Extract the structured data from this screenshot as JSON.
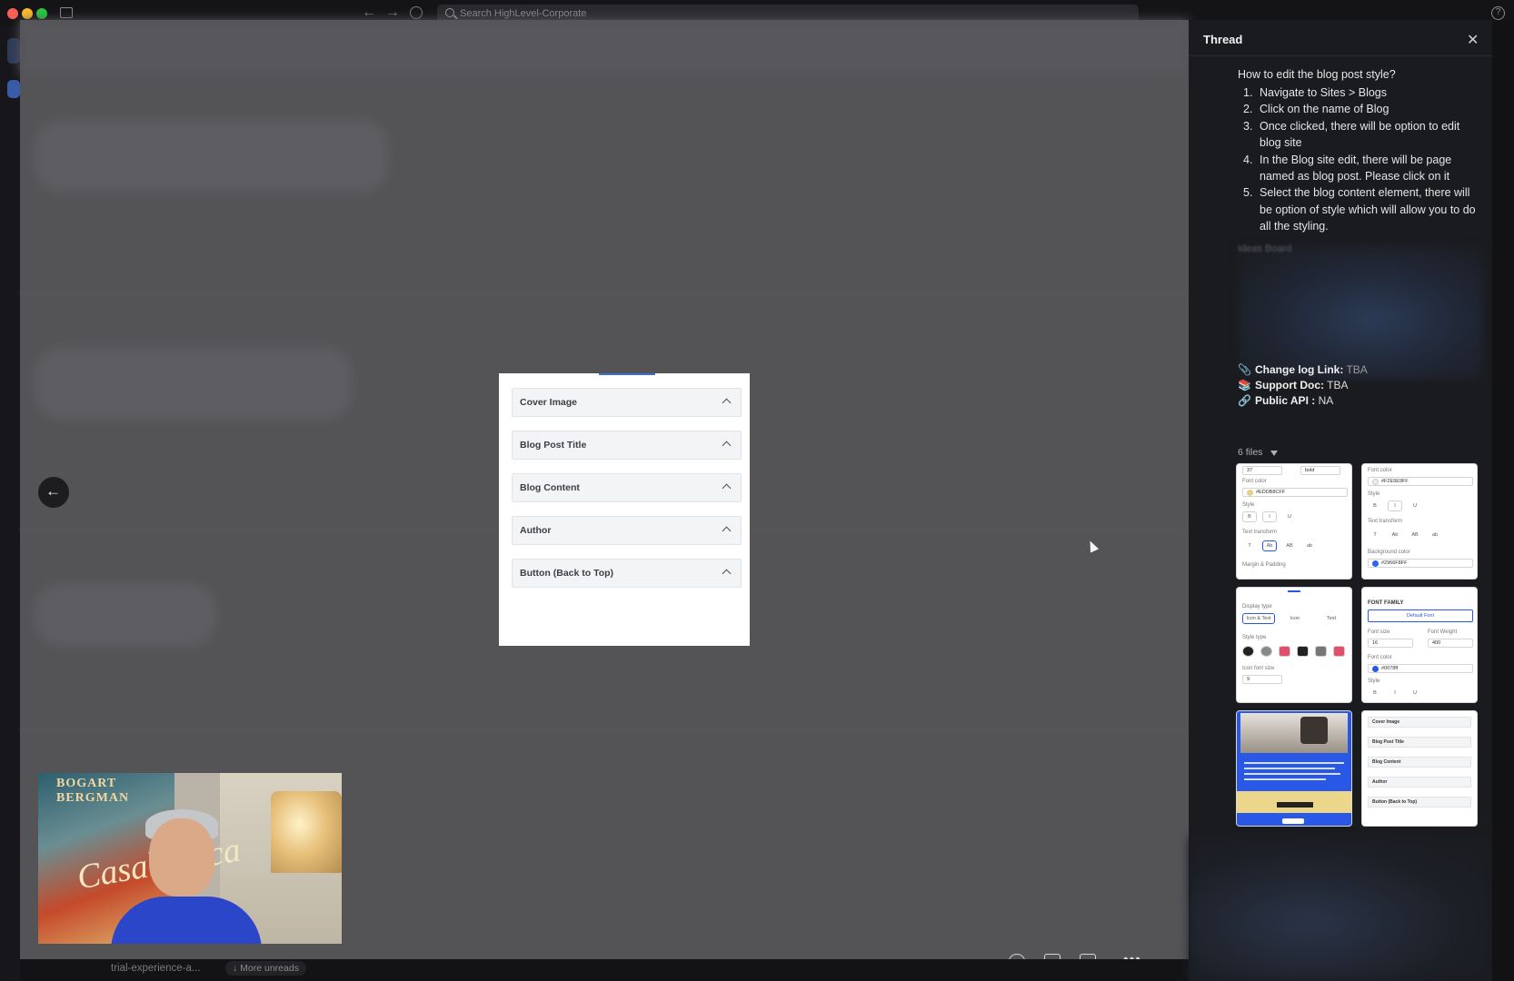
{
  "app": {
    "search_placeholder": "Search HighLevel-Corporate",
    "help": "?"
  },
  "viewer": {
    "accordion": [
      {
        "label": "Cover Image"
      },
      {
        "label": "Blog Post Title"
      },
      {
        "label": "Blog Content"
      },
      {
        "label": "Author"
      },
      {
        "label": "Button (Back to Top)"
      }
    ],
    "video": {
      "poster_title": "BOGART BERGMAN",
      "poster_script": "Casablanca"
    },
    "footer": {
      "channel": "trial-experience-a...",
      "more_unreads": "↓ More unreads"
    }
  },
  "thread": {
    "title": "Thread",
    "question": "How to edit the blog post style?",
    "steps": [
      {
        "num": "1.",
        "text": "Navigate to Sites > Blogs"
      },
      {
        "num": "2.",
        "text": "Click on the name of Blog"
      },
      {
        "num": "3.",
        "text": "Once clicked, there will be option to edit blog site"
      },
      {
        "num": "4.",
        "text": "In the Blog site edit, there will be page named as blog post. Please click on it"
      },
      {
        "num": "5.",
        "text": "Select the blog content element, there will be option of style which will allow you to do all the styling."
      }
    ],
    "blurred_heading": "Ideas Board",
    "meta": [
      {
        "icon": "📎",
        "label": "Change log Link:",
        "value": "TBA"
      },
      {
        "icon": "📚",
        "label": "Support Doc:",
        "value": "TBA"
      },
      {
        "icon": "🔗",
        "label": "Public API :",
        "value": "NA"
      }
    ],
    "files_label": "6 files",
    "thumb1": {
      "size": "37",
      "weight": "bold",
      "font_color_label": "Font color",
      "font_color": "#EDDB8CFF",
      "style_label": "Style",
      "b": "B",
      "i": "I",
      "u": "U",
      "transform_label": "Text transform",
      "margin_label": "Margin & Padding"
    },
    "thumb2": {
      "font_color_label": "Font color",
      "font_color": "#F2E9E9FF",
      "style_label": "Style",
      "b": "B",
      "i": "I",
      "u": "U",
      "transform_label": "Text transform",
      "bg_label": "Background color",
      "bg_color": "#2966F8FF"
    },
    "thumb3": {
      "display_label": "Display type",
      "opt1": "Icon & Text",
      "opt2": "Icon",
      "opt3": "Text",
      "style_label": "Style type",
      "icon_size_label": "Icon font size",
      "icon_size": "9"
    },
    "thumb4": {
      "family_label": "FONT FAMILY",
      "family": "Default Font",
      "size_label": "Font size",
      "size": "16",
      "weight_label": "Font Weight",
      "weight": "400",
      "color_label": "Font color",
      "color": "#0078ff",
      "style_label": "Style",
      "b": "B",
      "i": "I",
      "u": "U"
    },
    "thumb6": [
      "Cover Image",
      "Blog Post Title",
      "Blog Content",
      "Author",
      "Button (Back to Top)"
    ]
  },
  "colors": {
    "accent": "#3b6fe0",
    "panel": "#1a1b1e",
    "viewer_bg": "#545457"
  }
}
